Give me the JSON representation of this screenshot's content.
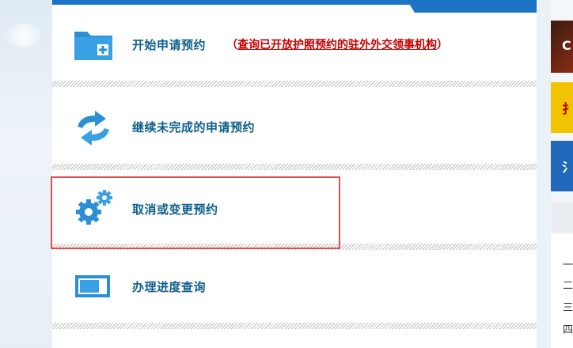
{
  "menu": {
    "items": [
      {
        "label": "开始申请预约",
        "icon": "folder-add-icon"
      },
      {
        "label": "继续未完成的申请预约",
        "icon": "refresh-arrows-icon"
      },
      {
        "label": "取消或变更预约",
        "icon": "gears-icon"
      },
      {
        "label": "办理进度查询",
        "icon": "progress-bar-icon"
      }
    ],
    "query_link": {
      "open_paren": "（",
      "text": "查询已开放护照预约的驻外外交领事机构",
      "close_paren": "）"
    }
  },
  "side_panel": {
    "glyphs": [
      "C",
      "扌",
      "氵"
    ],
    "list_markers": [
      "一",
      "二",
      "三",
      "四"
    ]
  },
  "colors": {
    "accent_blue": "#1d74c7",
    "label_teal": "#0e5f8b",
    "link_red": "#c40000",
    "highlight_border": "#e05050"
  }
}
